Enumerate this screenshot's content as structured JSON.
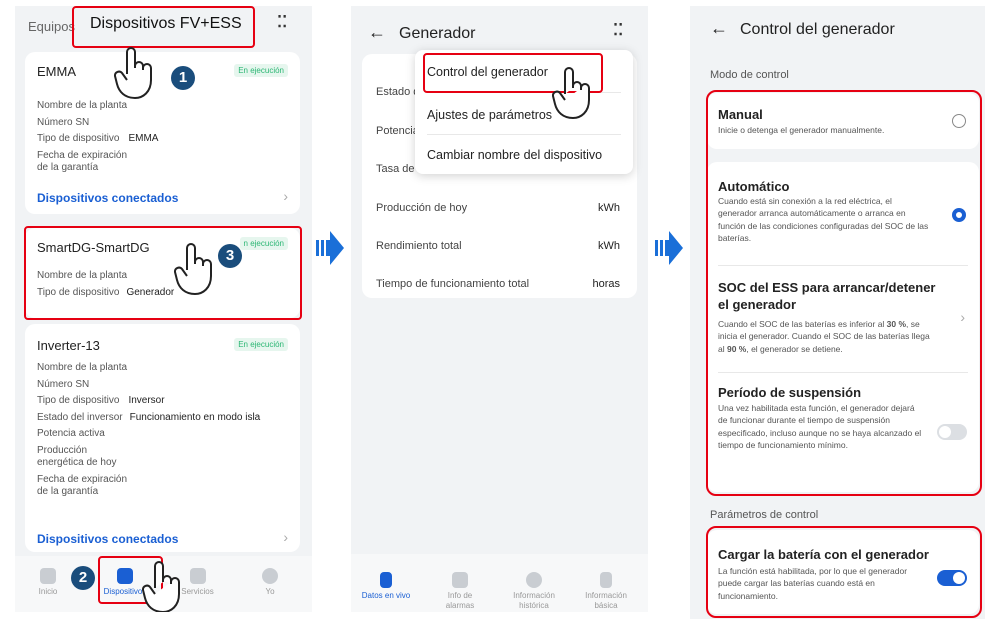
{
  "panel1": {
    "tabs": {
      "equipos": "Equipos",
      "dispositivos": "Dispositivos FV+ESS"
    },
    "more": "⁚⁚",
    "emma": {
      "name": "EMMA",
      "status": "En ejecución",
      "rows": [
        "Nombre de la planta",
        "Número SN",
        "Tipo de dispositivo",
        "Fecha de expiración",
        "de la garantía"
      ],
      "tipo_value": "EMMA",
      "link": "Dispositivos conectados"
    },
    "smartdg": {
      "name": "SmartDG-SmartDG",
      "status": "En ejecución",
      "status_visible": "n ejecución",
      "rows": [
        "Nombre de la planta",
        "Tipo de dispositivo"
      ],
      "tipo_value": "Generador"
    },
    "inverter": {
      "name": "Inverter-13",
      "status": "En ejecución",
      "rows": [
        "Nombre de la planta",
        "Número SN",
        "Tipo de dispositivo",
        "Estado del inversor",
        "Potencia activa",
        "Producción",
        "energética de hoy",
        "Fecha de expiración",
        "de la garantía"
      ],
      "tipo_value": "Inversor",
      "estado_value": "Funcionamiento en modo isla",
      "link": "Dispositivos conectados"
    },
    "nav": [
      "Inicio",
      "Dispositivos",
      "Servicios",
      "Yo"
    ],
    "steps": [
      "1",
      "2",
      "3"
    ]
  },
  "panel2": {
    "title": "Generador",
    "back": "←",
    "rows": [
      {
        "label": "Estado d",
        "unit": ""
      },
      {
        "label": "Potencia",
        "unit": ""
      },
      {
        "label": "Tasa de c",
        "unit": ""
      },
      {
        "label": "Producción de hoy",
        "unit": "kWh"
      },
      {
        "label": "Rendimiento total",
        "unit": "kWh"
      },
      {
        "label": "Tiempo de funcionamiento total",
        "unit": "horas"
      }
    ],
    "menu": [
      "Control del generador",
      "Ajustes de parámetros",
      "Cambiar nombre del dispositivo"
    ],
    "nav": [
      "Datos en vivo",
      "Info de alarmas",
      "Información histórica",
      "Información básica"
    ],
    "accent": "#1a5fd3"
  },
  "panel3": {
    "title": "Control del generador",
    "section1": "Modo de control",
    "manual": {
      "title": "Manual",
      "desc": "Inicie o detenga el generador manualmente."
    },
    "auto": {
      "title": "Automático",
      "desc": "Cuando está sin conexión a la red eléctrica, el generador arranca automáticamente o arranca en función de las condiciones configuradas del SOC de las baterías."
    },
    "soc": {
      "title1": "SOC del ESS para arrancar/detener",
      "title2": "el generador",
      "desc_a": "Cuando el SOC de las baterías es inferior al ",
      "v1": "30 %",
      "desc_b": ", se inicia el generador. Cuando el SOC de las baterías llega al ",
      "v2": "90 %",
      "desc_c": ", el generador se detiene."
    },
    "suspension": {
      "title": "Período de suspensión",
      "desc": "Una vez habilitada esta función, el generador dejará de funcionar durante el tiempo de suspensión especificado, incluso aunque no se haya alcanzado el tiempo de funcionamiento mínimo."
    },
    "section2": "Parámetros de control",
    "charge": {
      "title": "Cargar la batería con el generador",
      "desc": "La función está habilitada, por lo que el generador puede cargar las baterías cuando está en funcionamiento."
    }
  }
}
